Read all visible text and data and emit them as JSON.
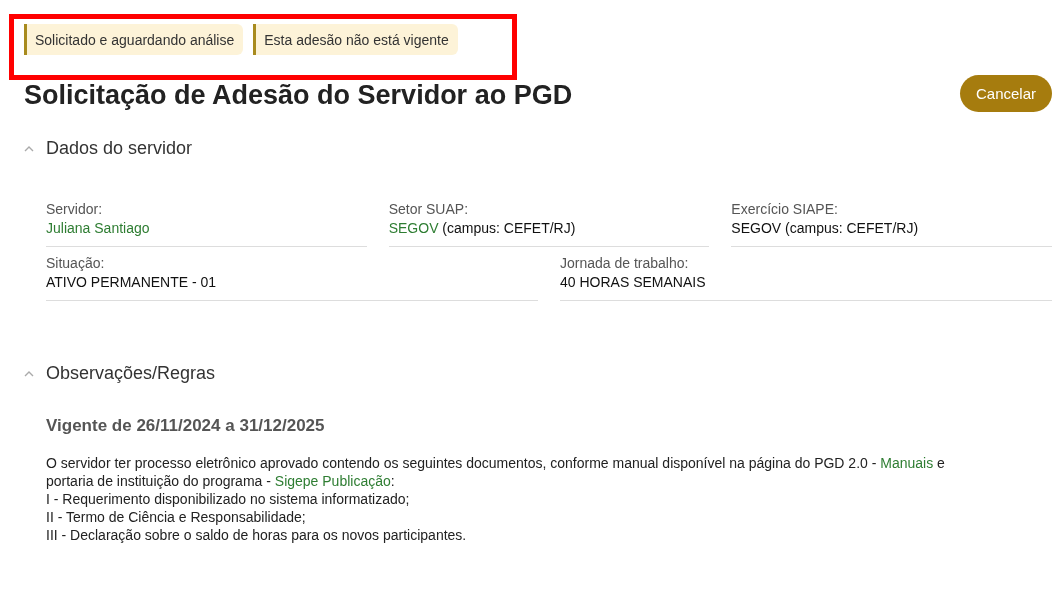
{
  "badges": [
    {
      "label": "Solicitado e aguardando análise"
    },
    {
      "label": "Esta adesão não está vigente"
    }
  ],
  "highlight": {
    "on": true
  },
  "title": "Solicitação de Adesão do Servidor ao PGD",
  "actions": [
    {
      "label": "Cancelar"
    }
  ],
  "sections": [
    {
      "kind": "fields",
      "heading": "Dados do servidor",
      "expanded": true,
      "rows": [
        [
          {
            "label": "Servidor:",
            "value": [
              {
                "kind": "link",
                "text": "Juliana Santiago"
              }
            ]
          },
          {
            "label": "Setor SUAP:",
            "value": [
              {
                "kind": "link",
                "text": "SEGOV"
              },
              {
                "kind": "text",
                "text": " (campus: CEFET/RJ)"
              }
            ]
          },
          {
            "label": "Exercício SIAPE:",
            "value": [
              {
                "kind": "text",
                "text": "SEGOV (campus: CEFET/RJ)"
              }
            ]
          }
        ],
        [
          {
            "label": "Situação:",
            "value": [
              {
                "kind": "text",
                "text": "ATIVO PERMANENTE - 01"
              }
            ]
          },
          {
            "label": "Jornada de trabalho:",
            "value": [
              {
                "kind": "text",
                "text": "40 HORAS SEMANAIS"
              }
            ]
          }
        ]
      ]
    },
    {
      "kind": "rules",
      "heading": "Observações/Regras",
      "expanded": true,
      "subheading": "Vigente de 26/11/2024 a 31/12/2025",
      "intro": [
        {
          "kind": "text",
          "text": "O servidor ter processo eletrônico aprovado contendo os seguintes documentos, conforme manual disponível na página do PGD 2.0 - "
        },
        {
          "kind": "link",
          "text": "Manuais"
        },
        {
          "kind": "text",
          "text": "  e "
        },
        {
          "kind": "text",
          "text": "portaria de instituição do programa - "
        },
        {
          "kind": "link",
          "text": "Sigepe Publicação"
        },
        {
          "kind": "text",
          "text": ":"
        }
      ],
      "items": [
        "I - Requerimento disponibilizado no sistema informatizado;",
        "II - Termo de Ciência e Responsabilidade;",
        "III - Declaração sobre o saldo de horas para os novos participantes."
      ]
    }
  ]
}
